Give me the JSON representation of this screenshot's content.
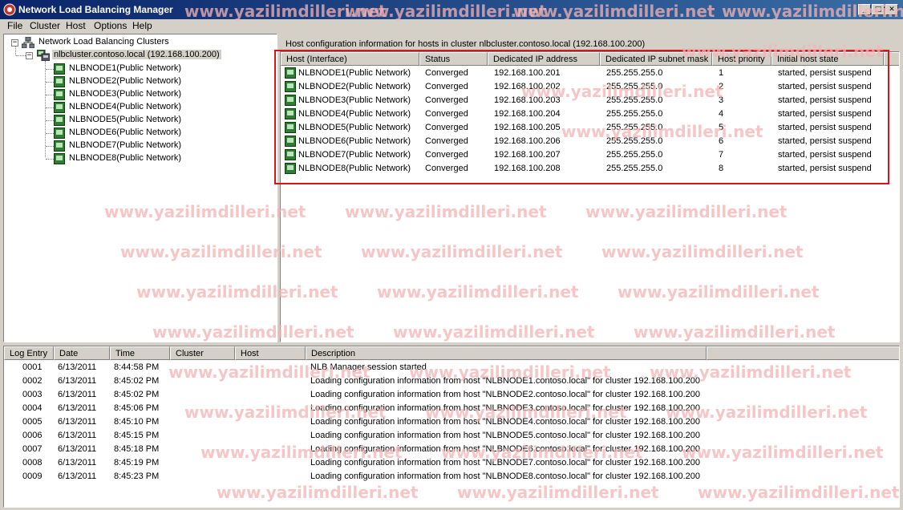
{
  "window": {
    "title": "Network Load Balancing Manager",
    "minimize": "_",
    "maximize": "□",
    "close": "✕"
  },
  "menu": [
    "File",
    "Cluster",
    "Host",
    "Options",
    "Help"
  ],
  "tree": {
    "root": "Network Load Balancing Clusters",
    "cluster": "nlbcluster.contoso.local (192.168.100.200)",
    "nodes": [
      "NLBNODE1(Public Network)",
      "NLBNODE2(Public Network)",
      "NLBNODE3(Public Network)",
      "NLBNODE4(Public Network)",
      "NLBNODE5(Public Network)",
      "NLBNODE6(Public Network)",
      "NLBNODE7(Public Network)",
      "NLBNODE8(Public Network)"
    ]
  },
  "hosts_panel": {
    "caption": "Host configuration information for hosts in cluster nlbcluster.contoso.local (192.168.100.200)",
    "columns": [
      "Host (Interface)",
      "Status",
      "Dedicated IP address",
      "Dedicated IP subnet mask",
      "Host priority",
      "Initial host state"
    ],
    "rows": [
      [
        "NLBNODE1(Public Network)",
        "Converged",
        "192.168.100.201",
        "255.255.255.0",
        "1",
        "started, persist suspend"
      ],
      [
        "NLBNODE2(Public Network)",
        "Converged",
        "192.168.100.202",
        "255.255.255.0",
        "2",
        "started, persist suspend"
      ],
      [
        "NLBNODE3(Public Network)",
        "Converged",
        "192.168.100.203",
        "255.255.255.0",
        "3",
        "started, persist suspend"
      ],
      [
        "NLBNODE4(Public Network)",
        "Converged",
        "192.168.100.204",
        "255.255.255.0",
        "4",
        "started, persist suspend"
      ],
      [
        "NLBNODE5(Public Network)",
        "Converged",
        "192.168.100.205",
        "255.255.255.0",
        "5",
        "started, persist suspend"
      ],
      [
        "NLBNODE6(Public Network)",
        "Converged",
        "192.168.100.206",
        "255.255.255.0",
        "6",
        "started, persist suspend"
      ],
      [
        "NLBNODE7(Public Network)",
        "Converged",
        "192.168.100.207",
        "255.255.255.0",
        "7",
        "started, persist suspend"
      ],
      [
        "NLBNODE8(Public Network)",
        "Converged",
        "192.168.100.208",
        "255.255.255.0",
        "8",
        "started, persist suspend"
      ]
    ]
  },
  "log": {
    "columns": [
      "Log Entry",
      "Date",
      "Time",
      "Cluster",
      "Host",
      "Description"
    ],
    "rows": [
      [
        "0001",
        "6/13/2011",
        "8:44:58 PM",
        "",
        "",
        "NLB Manager session started"
      ],
      [
        "0002",
        "6/13/2011",
        "8:45:02 PM",
        "",
        "",
        "Loading configuration information from host \"NLBNODE1.contoso.local\" for cluster 192.168.100.200"
      ],
      [
        "0003",
        "6/13/2011",
        "8:45:02 PM",
        "",
        "",
        "Loading configuration information from host \"NLBNODE2.contoso.local\" for cluster 192.168.100.200"
      ],
      [
        "0004",
        "6/13/2011",
        "8:45:06 PM",
        "",
        "",
        "Loading configuration information from host \"NLBNODE3.contoso.local\" for cluster 192.168.100.200"
      ],
      [
        "0005",
        "6/13/2011",
        "8:45:10 PM",
        "",
        "",
        "Loading configuration information from host \"NLBNODE4.contoso.local\" for cluster 192.168.100.200"
      ],
      [
        "0006",
        "6/13/2011",
        "8:45:15 PM",
        "",
        "",
        "Loading configuration information from host \"NLBNODE5.contoso.local\" for cluster 192.168.100.200"
      ],
      [
        "0007",
        "6/13/2011",
        "8:45:18 PM",
        "",
        "",
        "Loading configuration information from host \"NLBNODE6.contoso.local\" for cluster 192.168.100.200"
      ],
      [
        "0008",
        "6/13/2011",
        "8:45:19 PM",
        "",
        "",
        "Loading configuration information from host \"NLBNODE7.contoso.local\" for cluster 192.168.100.200"
      ],
      [
        "0009",
        "6/13/2011",
        "8:45:23 PM",
        "",
        "",
        "Loading configuration information from host \"NLBNODE8.contoso.local\" for cluster 192.168.100.200"
      ]
    ]
  },
  "watermark": "www.yazilimdilleri.net",
  "colors": {
    "titlebar_start": "#0a246a",
    "titlebar_end": "#3a6ea5",
    "highlight_box": "#d4161c",
    "watermark": "#f4b4b4",
    "host_icon": "#2e7d32"
  }
}
